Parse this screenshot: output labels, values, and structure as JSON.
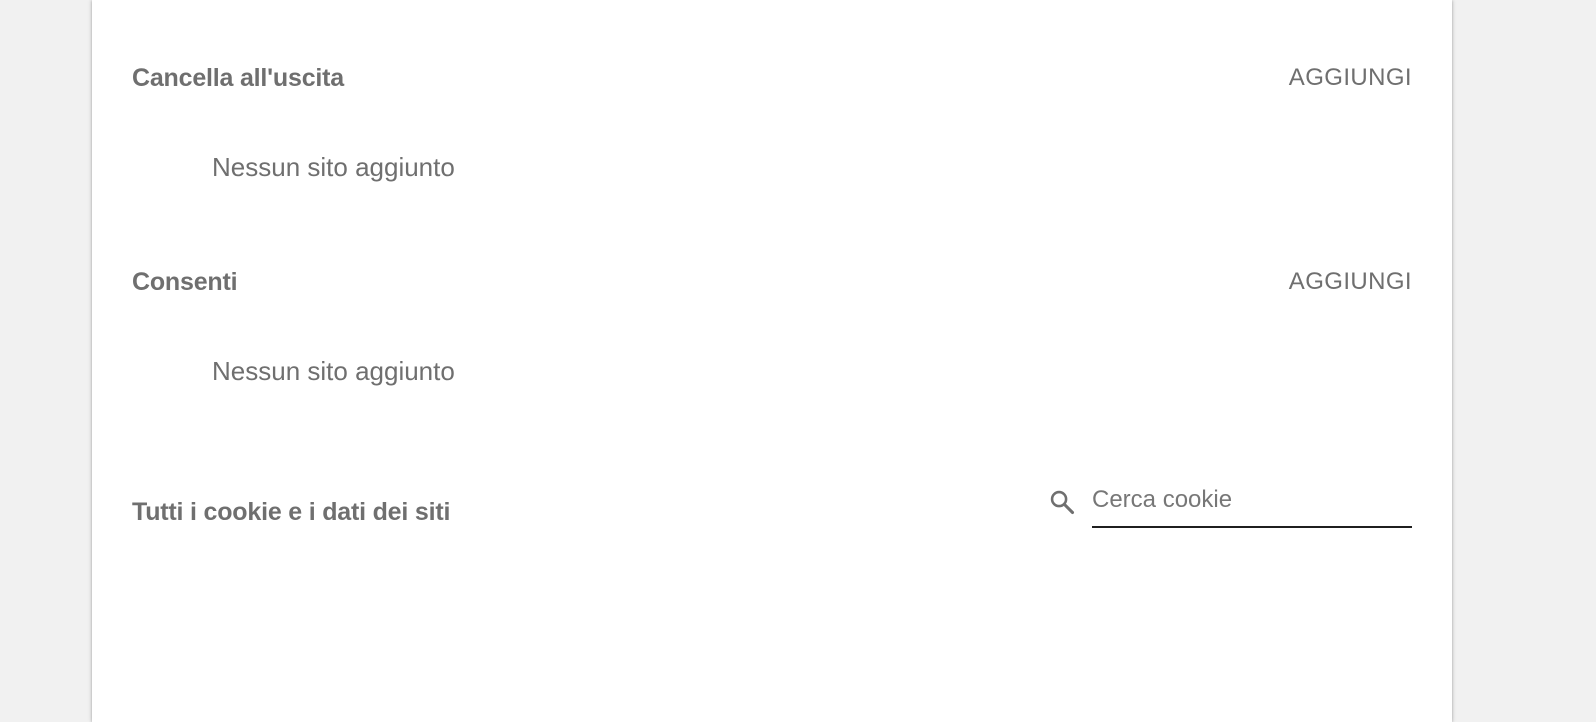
{
  "sections": [
    {
      "title": "Cancella all'uscita",
      "add_label": "AGGIUNGI",
      "empty_text": "Nessun sito aggiunto"
    },
    {
      "title": "Consenti",
      "add_label": "AGGIUNGI",
      "empty_text": "Nessun sito aggiunto"
    }
  ],
  "all_cookies": {
    "title": "Tutti i cookie e i dati dei siti",
    "search_placeholder": "Cerca cookie",
    "search_value": "",
    "search_icon": "search-icon"
  },
  "colors": {
    "text_gray": "#6f6f6f",
    "page_bg": "#f1f1f1",
    "card_bg": "#ffffff",
    "underline": "#1f1f1f"
  }
}
